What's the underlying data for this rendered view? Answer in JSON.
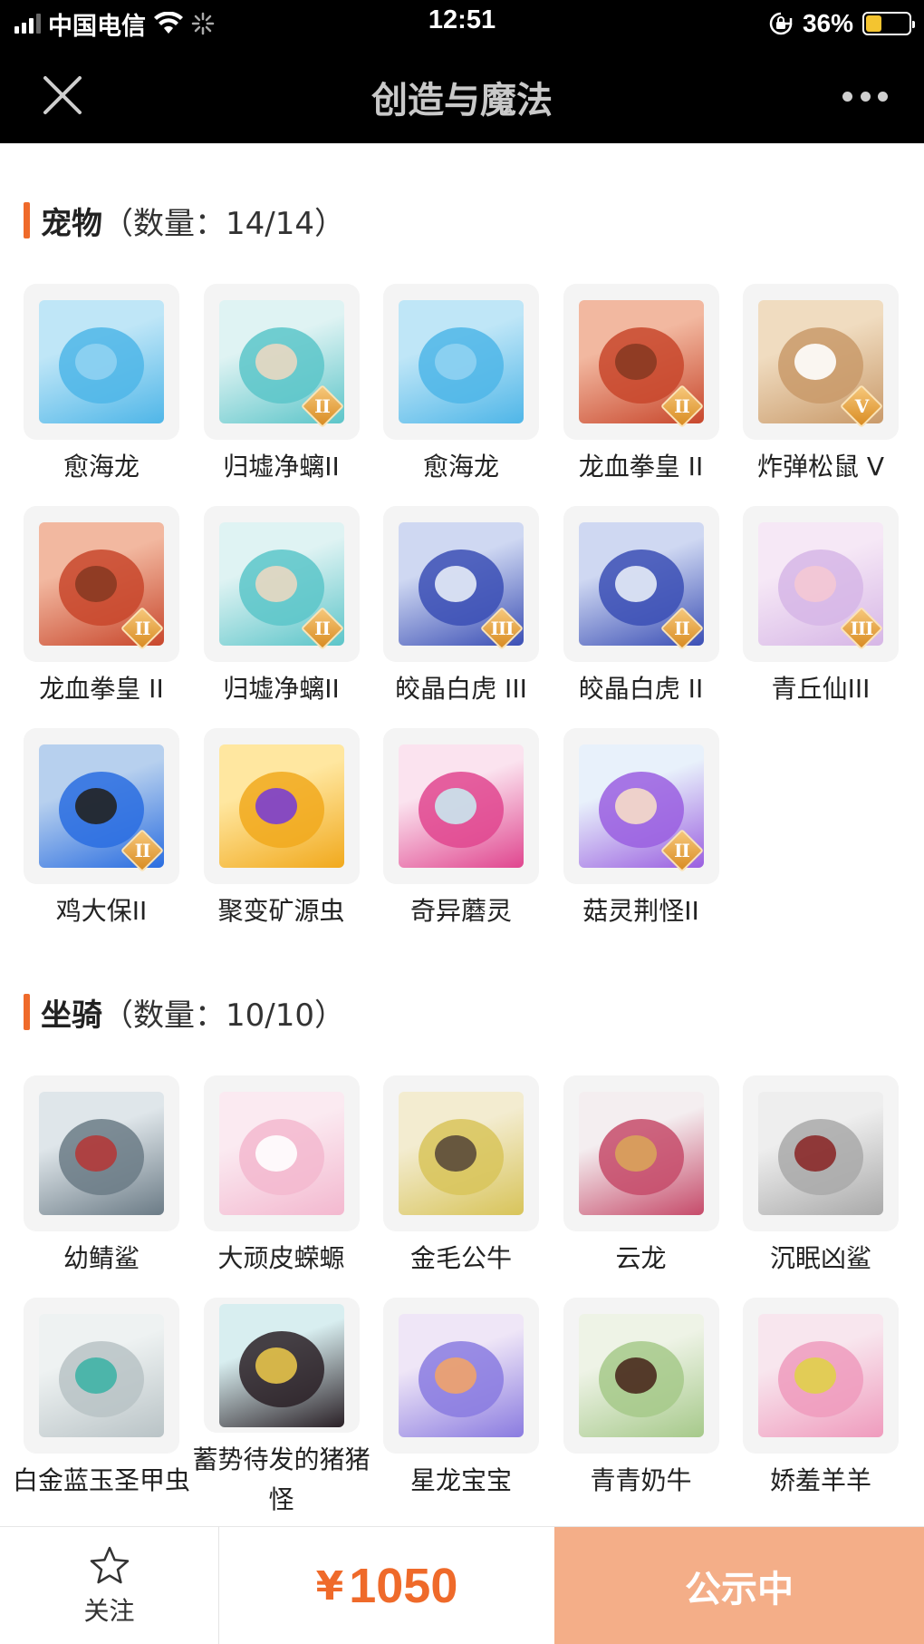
{
  "status_bar": {
    "carrier": "中国电信",
    "time": "12:51",
    "battery_percent": "36%",
    "battery_level": 0.36,
    "icons": [
      "signal-icon",
      "wifi-icon",
      "loading-icon",
      "rotation-lock-icon",
      "battery-icon"
    ]
  },
  "nav": {
    "title": "创造与魔法",
    "close_icon": "close-icon",
    "more_icon": "more-icon"
  },
  "pets": {
    "title": "宠物",
    "count": "（数量：14/14）",
    "items": [
      {
        "name": "愈海龙",
        "grade": "",
        "art": "blue-dragon"
      },
      {
        "name": "归墟净螭II",
        "grade": "II",
        "art": "teal-serpent"
      },
      {
        "name": "愈海龙",
        "grade": "",
        "art": "blue-dragon"
      },
      {
        "name": "龙血拳皇 II",
        "grade": "II",
        "art": "red-ram"
      },
      {
        "name": "炸弹松鼠 V",
        "grade": "V",
        "art": "squirrel"
      },
      {
        "name": "龙血拳皇 II",
        "grade": "II",
        "art": "red-ram"
      },
      {
        "name": "归墟净螭II",
        "grade": "II",
        "art": "teal-serpent"
      },
      {
        "name": "皎晶白虎 III",
        "grade": "III",
        "art": "white-tiger"
      },
      {
        "name": "皎晶白虎 II",
        "grade": "II",
        "art": "white-tiger"
      },
      {
        "name": "青丘仙III",
        "grade": "III",
        "art": "fox-fairy"
      },
      {
        "name": "鸡大保II",
        "grade": "II",
        "art": "blue-bird"
      },
      {
        "name": "聚变矿源虫",
        "grade": "",
        "art": "gold-bug"
      },
      {
        "name": "奇异蘑灵",
        "grade": "",
        "art": "mushroom"
      },
      {
        "name": "菇灵荆怪II",
        "grade": "II",
        "art": "purple-sprite"
      }
    ]
  },
  "mounts": {
    "title": "坐骑",
    "count": "（数量：10/10）",
    "items": [
      {
        "name": "幼鲭鲨",
        "grade": "",
        "art": "shark"
      },
      {
        "name": "大顽皮蝾螈",
        "grade": "",
        "art": "axolotl"
      },
      {
        "name": "金毛公牛",
        "grade": "",
        "art": "yak"
      },
      {
        "name": "云龙",
        "grade": "",
        "art": "cloud-dragon"
      },
      {
        "name": "沉眠凶鲨",
        "grade": "",
        "art": "white-shark"
      },
      {
        "name": "白金蓝玉圣甲虫",
        "grade": "",
        "art": "silver-beetle"
      },
      {
        "name": "蓄势待发的猪猪怪",
        "grade": "",
        "art": "black-pig"
      },
      {
        "name": "星龙宝宝",
        "grade": "",
        "art": "star-dragon"
      },
      {
        "name": "青青奶牛",
        "grade": "",
        "art": "green-cow"
      },
      {
        "name": "娇羞羊羊",
        "grade": "",
        "art": "pink-sheep"
      }
    ]
  },
  "bottom_bar": {
    "follow_label": "关注",
    "follow_icon": "star-icon",
    "currency": "¥",
    "price": "1050",
    "status_button": "公示中",
    "accent_color": "#ef6a2a",
    "button_color": "#f4ae88"
  }
}
